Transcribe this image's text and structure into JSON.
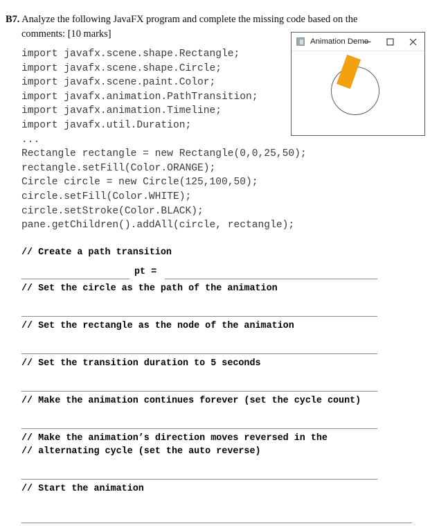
{
  "question": {
    "label": "B7.",
    "line1": "Analyze the following JavaFX program and complete the missing code based on the",
    "line2": "comments: [10 marks]"
  },
  "code": {
    "lines": [
      "import javafx.scene.shape.Rectangle;",
      "import javafx.scene.shape.Circle;",
      "import javafx.scene.paint.Color;",
      "import javafx.animation.PathTransition;",
      "import javafx.animation.Timeline;",
      "import javafx.util.Duration;",
      "...",
      "Rectangle rectangle = new Rectangle(0,0,25,50);",
      "rectangle.setFill(Color.ORANGE);",
      "Circle circle = new Circle(125,100,50);",
      "circle.setFill(Color.WHITE);",
      "circle.setStroke(Color.BLACK);",
      "pane.getChildren().addAll(circle, rectangle);"
    ]
  },
  "answers": {
    "comment_create_path": "// Create a path transition",
    "pt_declaration": "pt =",
    "comment_set_circle": "// Set the circle as the path of the animation",
    "comment_set_rectangle": "// Set the rectangle as the node of the animation",
    "comment_set_duration": "// Set the transition duration to 5 seconds",
    "comment_cycle_count": "// Make the animation continues forever (set the cycle count)",
    "comment_auto_reverse_1": "// Make the animation’s direction moves reversed in the",
    "comment_auto_reverse_2": "// alternating cycle (set the auto reverse)",
    "comment_start": "// Start the animation"
  },
  "app_window": {
    "title": "Animation Demo",
    "minimize_label": "—",
    "maximize_label": "□",
    "close_label": "✕",
    "shapes": {
      "circle_stroke": "#5a5a60",
      "circle_fill": "#FFFFFF",
      "rectangle_fill": "#F2A00F"
    }
  }
}
